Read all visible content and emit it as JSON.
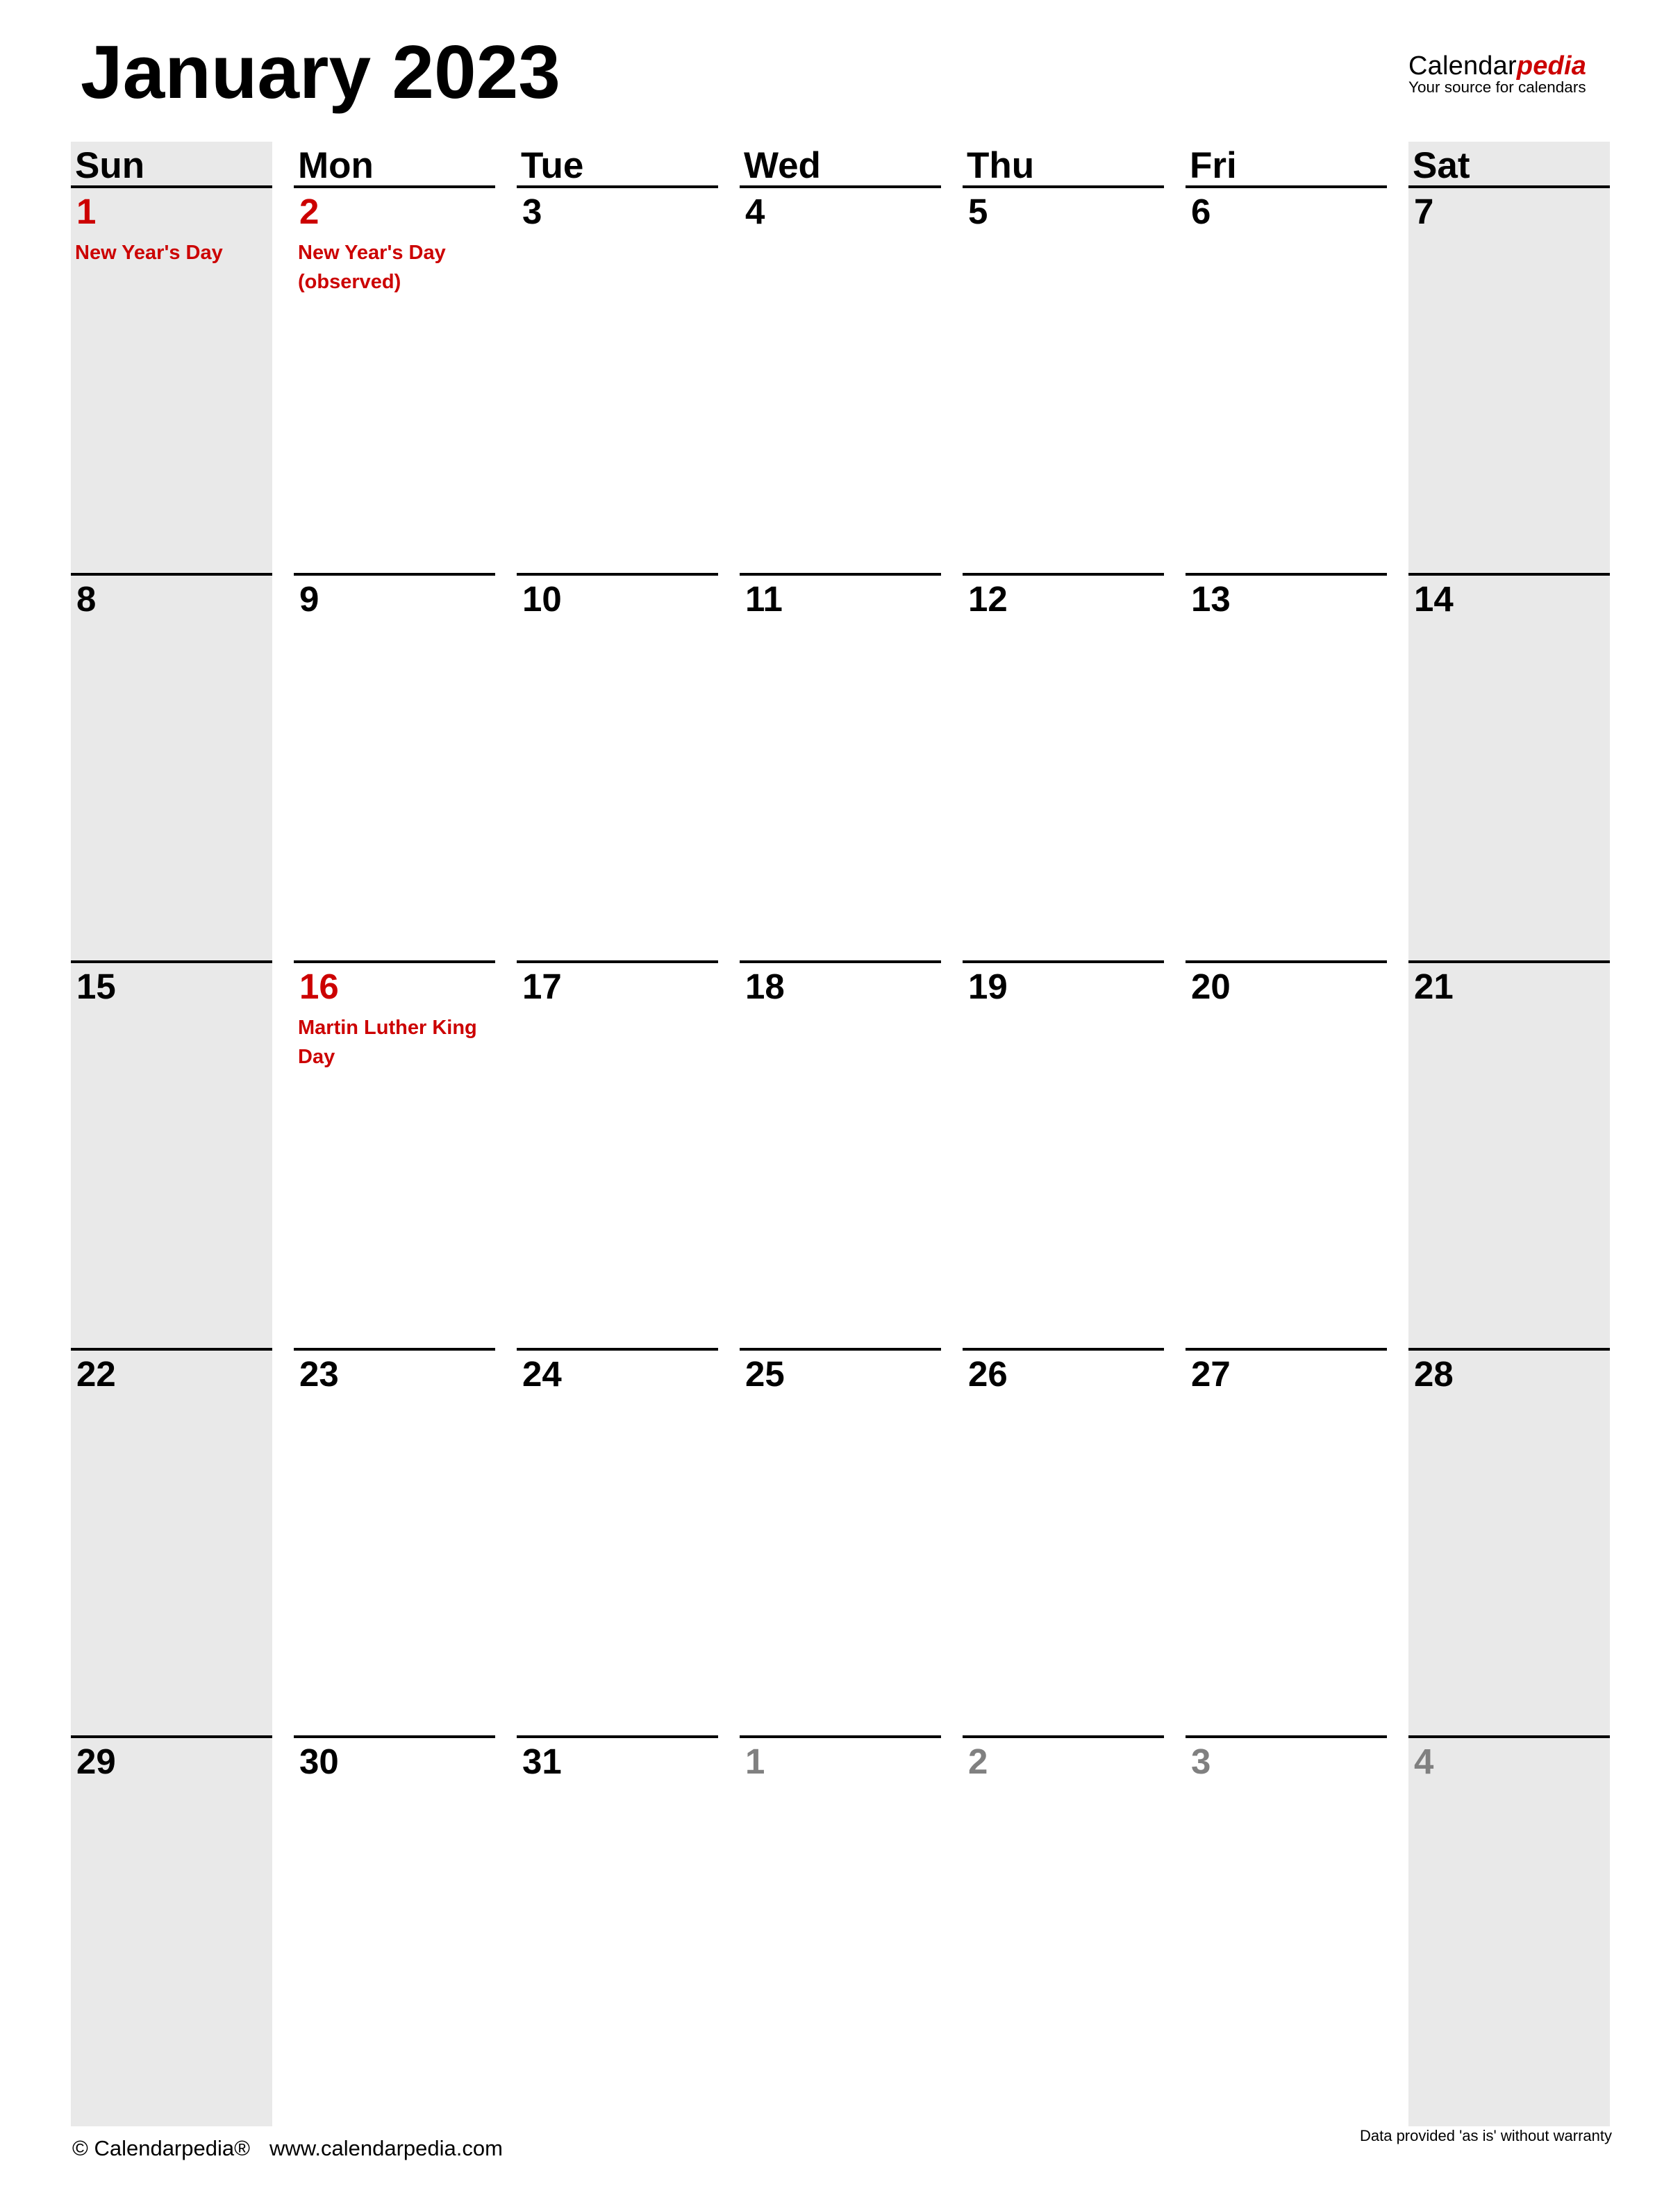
{
  "title": "January 2023",
  "logo": {
    "name_plain": "Calendar",
    "name_accent": "pedia",
    "tagline": "Your source for calendars",
    "accent_color": "#cc0000"
  },
  "weekdays": [
    "Sun",
    "Mon",
    "Tue",
    "Wed",
    "Thu",
    "Fri",
    "Sat"
  ],
  "weeks": [
    [
      {
        "day": "1",
        "type": "holiday",
        "holiday": "New Year's Day"
      },
      {
        "day": "2",
        "type": "holiday",
        "holiday": "New Year's Day (observed)"
      },
      {
        "day": "3",
        "type": "normal",
        "holiday": ""
      },
      {
        "day": "4",
        "type": "normal",
        "holiday": ""
      },
      {
        "day": "5",
        "type": "normal",
        "holiday": ""
      },
      {
        "day": "6",
        "type": "normal",
        "holiday": ""
      },
      {
        "day": "7",
        "type": "normal",
        "holiday": ""
      }
    ],
    [
      {
        "day": "8",
        "type": "normal",
        "holiday": ""
      },
      {
        "day": "9",
        "type": "normal",
        "holiday": ""
      },
      {
        "day": "10",
        "type": "normal",
        "holiday": ""
      },
      {
        "day": "11",
        "type": "normal",
        "holiday": ""
      },
      {
        "day": "12",
        "type": "normal",
        "holiday": ""
      },
      {
        "day": "13",
        "type": "normal",
        "holiday": ""
      },
      {
        "day": "14",
        "type": "normal",
        "holiday": ""
      }
    ],
    [
      {
        "day": "15",
        "type": "normal",
        "holiday": ""
      },
      {
        "day": "16",
        "type": "holiday",
        "holiday": "Martin Luther King Day"
      },
      {
        "day": "17",
        "type": "normal",
        "holiday": ""
      },
      {
        "day": "18",
        "type": "normal",
        "holiday": ""
      },
      {
        "day": "19",
        "type": "normal",
        "holiday": ""
      },
      {
        "day": "20",
        "type": "normal",
        "holiday": ""
      },
      {
        "day": "21",
        "type": "normal",
        "holiday": ""
      }
    ],
    [
      {
        "day": "22",
        "type": "normal",
        "holiday": ""
      },
      {
        "day": "23",
        "type": "normal",
        "holiday": ""
      },
      {
        "day": "24",
        "type": "normal",
        "holiday": ""
      },
      {
        "day": "25",
        "type": "normal",
        "holiday": ""
      },
      {
        "day": "26",
        "type": "normal",
        "holiday": ""
      },
      {
        "day": "27",
        "type": "normal",
        "holiday": ""
      },
      {
        "day": "28",
        "type": "normal",
        "holiday": ""
      }
    ],
    [
      {
        "day": "29",
        "type": "normal",
        "holiday": ""
      },
      {
        "day": "30",
        "type": "normal",
        "holiday": ""
      },
      {
        "day": "31",
        "type": "normal",
        "holiday": ""
      },
      {
        "day": "1",
        "type": "other",
        "holiday": ""
      },
      {
        "day": "2",
        "type": "other",
        "holiday": ""
      },
      {
        "day": "3",
        "type": "other",
        "holiday": ""
      },
      {
        "day": "4",
        "type": "other",
        "holiday": ""
      }
    ]
  ],
  "colors": {
    "holiday": "#cc0000",
    "other_month": "#808080",
    "weekend_background": "#e9e9e9"
  },
  "footer": {
    "copyright": "© Calendarpedia®",
    "url": "www.calendarpedia.com",
    "disclaimer": "Data provided 'as is' without warranty"
  }
}
